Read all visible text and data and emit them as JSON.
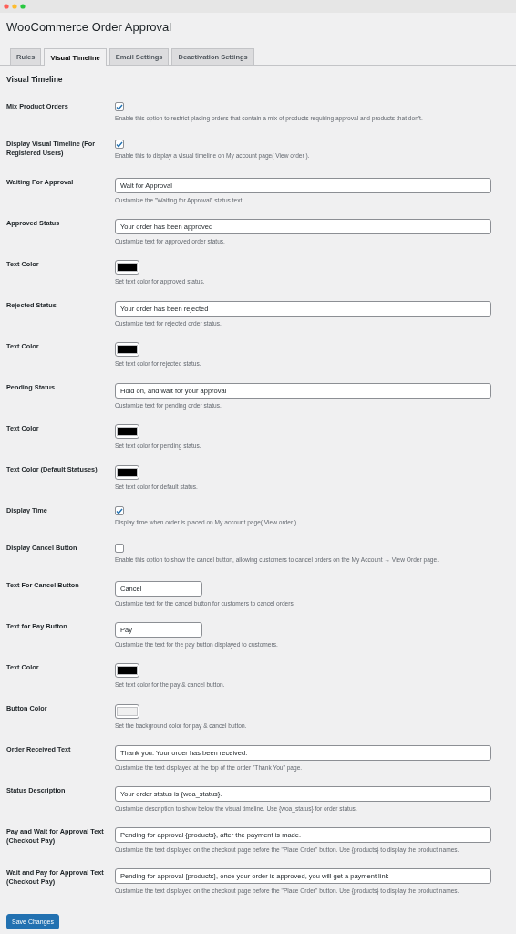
{
  "window": {
    "title": "WooCommerce Order Approval"
  },
  "tabs": [
    {
      "label": "Rules",
      "selected": false
    },
    {
      "label": "Visual Timeline",
      "selected": true
    },
    {
      "label": "Email Settings",
      "selected": false
    },
    {
      "label": "Deactivation Settings",
      "selected": false
    }
  ],
  "section_title": "Visual Timeline",
  "settings": [
    {
      "kind": "checkbox",
      "label": "Mix Product Orders",
      "checked": true,
      "description": "Enable this option to restrict placing orders that contain a mix of products requiring approval and products that don't."
    },
    {
      "kind": "checkbox",
      "label": "Display Visual Timeline (For Registered Users)",
      "checked": true,
      "description": "Enable this to display a visual timeline on My account page( View order )."
    },
    {
      "kind": "text",
      "label": "Waiting For Approval",
      "value": "Wait for Approval",
      "description": "Customize the \"Waiting for Approval\" status text."
    },
    {
      "kind": "text",
      "label": "Approved Status",
      "value": "Your order has been approved",
      "description": "Customize text for approved order status."
    },
    {
      "kind": "color",
      "label": "Text Color",
      "color": "#000000",
      "description": "Set text color for approved status."
    },
    {
      "kind": "text",
      "label": "Rejected Status",
      "value": "Your order has been rejected",
      "description": "Customize text for rejected order status."
    },
    {
      "kind": "color",
      "label": "Text Color",
      "color": "#000000",
      "description": "Set text color for rejected status."
    },
    {
      "kind": "text",
      "label": "Pending Status",
      "value": "Hold on, and wait for your approval",
      "description": "Customize text for pending order status."
    },
    {
      "kind": "color",
      "label": "Text Color",
      "color": "#000000",
      "description": "Set text color for pending status."
    },
    {
      "kind": "color",
      "label": "Text Color (Default Statuses)",
      "color": "#000000",
      "description": "Set text color for default status."
    },
    {
      "kind": "checkbox",
      "label": "Display Time",
      "checked": true,
      "description": "Display time when order is placed on My account page( View order )."
    },
    {
      "kind": "checkbox",
      "label": "Display Cancel Button",
      "checked": false,
      "description": "Enable this option to show the cancel button, allowing customers to cancel orders on the My Account → View Order page."
    },
    {
      "kind": "short_text",
      "label": "Text For Cancel Button",
      "value": "Cancel",
      "description": "Customize text for the cancel button for customers to cancel orders."
    },
    {
      "kind": "short_text",
      "label": "Text for Pay Button",
      "value": "Pay",
      "description": "Customize the text for the pay button displayed to customers."
    },
    {
      "kind": "color",
      "label": "Text Color",
      "color": "#000000",
      "description": "Set text color for the pay & cancel button."
    },
    {
      "kind": "color",
      "label": "Button Color",
      "color": "#f0f0f0",
      "description": "Set the background color for pay & cancel button."
    },
    {
      "kind": "text",
      "label": "Order Received Text",
      "value": "Thank you. Your order has been received.",
      "description": "Customize the text displayed at the top of the order \"Thank You\" page."
    },
    {
      "kind": "text",
      "label": "Status Description",
      "value": "Your order status is {woa_status}.",
      "description": "Customize description to show below the visual timeline. Use {woa_status} for order status."
    },
    {
      "kind": "text",
      "label": "Pay and Wait for Approval Text (Checkout Pay)",
      "value": "Pending for approval {products}, after the payment is made.",
      "description": "Customize the text displayed on the checkout page before the \"Place Order\" button. Use {products} to display the product names."
    },
    {
      "kind": "text",
      "label": "Wait and Pay for Approval Text (Checkout Pay)",
      "value": "Pending for approval {products}, once your order is approved, you will get a payment link",
      "description": "Customize the text displayed on the checkout page before the \"Place Order\" button. Use {products} to display the product names."
    }
  ],
  "save_button": "Save Changes"
}
